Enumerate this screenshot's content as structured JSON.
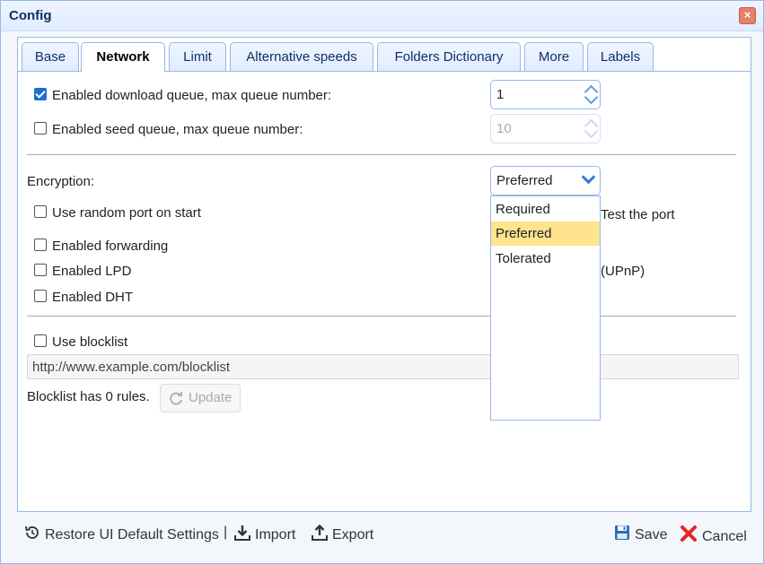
{
  "window": {
    "title": "Config",
    "close_label": "×"
  },
  "tabs": [
    {
      "label": "Base"
    },
    {
      "label": "Network"
    },
    {
      "label": "Limit"
    },
    {
      "label": "Alternative speeds"
    },
    {
      "label": "Folders Dictionary"
    },
    {
      "label": "More"
    },
    {
      "label": "Labels"
    }
  ],
  "queue": {
    "download_label": "Enabled download queue, max queue number:",
    "download_value": "1",
    "seed_label": "Enabled seed queue, max queue number:",
    "seed_value": "10"
  },
  "encryption": {
    "label": "Encryption:",
    "selected": "Preferred",
    "options": [
      "Required",
      "Preferred",
      "Tolerated"
    ]
  },
  "network": {
    "random_port_label": "Use random port on start",
    "test_port_label": "Test the port",
    "forwarding_label": "Enabled forwarding",
    "upnp_label": "(UPnP)",
    "lpd_label": "Enabled LPD",
    "dht_label": "Enabled DHT"
  },
  "blocklist": {
    "use_label": "Use blocklist",
    "url_value": "http://www.example.com/blocklist",
    "rules_text": "Blocklist has 0 rules.",
    "update_label": "Update"
  },
  "footer": {
    "restore_label": "Restore UI Default Settings",
    "separator": "|",
    "import_label": "Import",
    "export_label": "Export",
    "save_label": "Save",
    "cancel_label": "Cancel"
  },
  "colors": {
    "accent": "#95b8e7",
    "selected_option": "#ffe48d",
    "cancel_red": "#e0262b",
    "save_blue": "#2b6cb8"
  }
}
